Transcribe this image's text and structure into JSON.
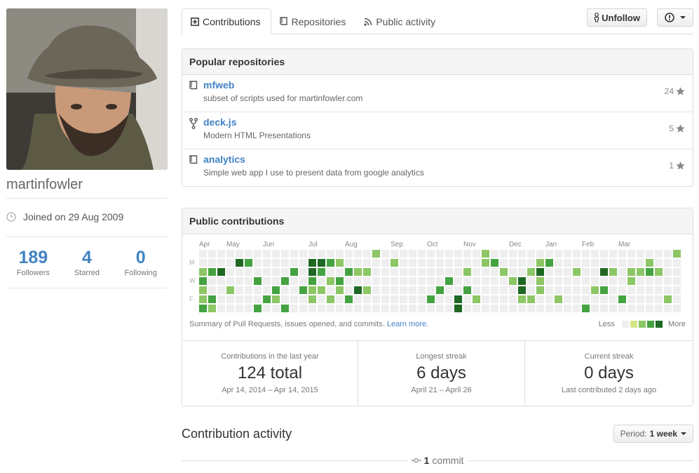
{
  "profile": {
    "username": "martinfowler",
    "joined": "Joined on 29 Aug 2009",
    "stats": [
      {
        "value": "189",
        "label": "Followers"
      },
      {
        "value": "4",
        "label": "Starred"
      },
      {
        "value": "0",
        "label": "Following"
      }
    ]
  },
  "tabs": [
    {
      "label": "Contributions",
      "icon": "contributions-icon",
      "active": true
    },
    {
      "label": "Repositories",
      "icon": "repo-icon",
      "active": false
    },
    {
      "label": "Public activity",
      "icon": "rss-icon",
      "active": false
    }
  ],
  "actions": {
    "unfollow": "Unfollow"
  },
  "popular": {
    "title": "Popular repositories",
    "repos": [
      {
        "name": "mfweb",
        "desc": "subset of scripts used for martinfowler.com",
        "stars": "24",
        "icon": "repo-icon"
      },
      {
        "name": "deck.js",
        "desc": "Modern HTML Presentations",
        "stars": "5",
        "icon": "fork-icon"
      },
      {
        "name": "analytics",
        "desc": "Simple web app I use to present data from google analytics",
        "stars": "1",
        "icon": "repo-icon"
      }
    ]
  },
  "contributions": {
    "title": "Public contributions",
    "months": [
      "Apr",
      "May",
      "Jun",
      "Jul",
      "Aug",
      "Sep",
      "Oct",
      "Nov",
      "Dec",
      "Jan",
      "Feb",
      "Mar"
    ],
    "days": [
      "M",
      "W",
      "F"
    ],
    "summary": "Summary of Pull Requests, issues opened, and commits.",
    "learn_more": "Learn more.",
    "legend_less": "Less",
    "legend_more": "More",
    "colors": [
      "#eeeeee",
      "#d6e685",
      "#8cc665",
      "#44a340",
      "#1e6823"
    ],
    "streaks": [
      {
        "label": "Contributions in the last year",
        "value": "124 total",
        "sub": "Apr 14, 2014 – Apr 14, 2015"
      },
      {
        "label": "Longest streak",
        "value": "6 days",
        "sub": "April 21 – April 26"
      },
      {
        "label": "Current streak",
        "value": "0 days",
        "sub": "Last contributed 2 days ago"
      }
    ]
  },
  "activity": {
    "title": "Contribution activity",
    "period_label": "Period:",
    "period_value": "1 week",
    "commit_count": "1",
    "commit_word": "commit"
  }
}
